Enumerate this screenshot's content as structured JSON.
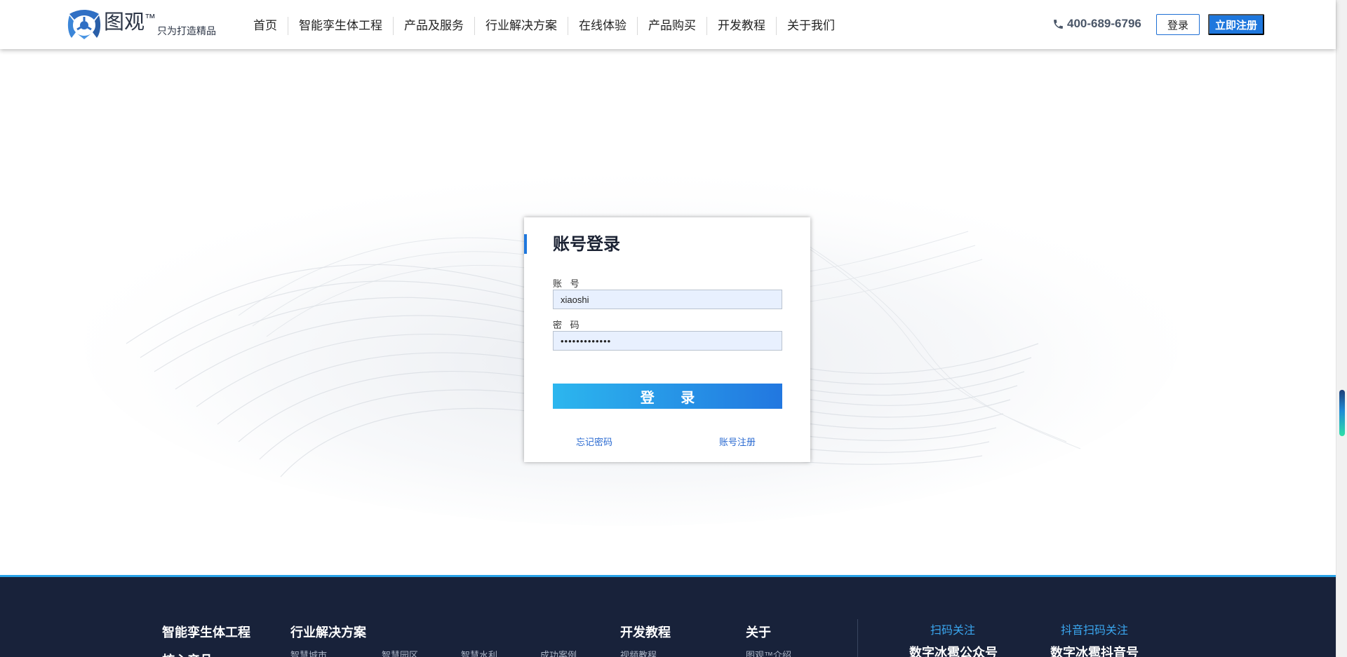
{
  "header": {
    "brand_name": "图观",
    "brand_tm": "™",
    "slogan": "只为打造精品",
    "nav": [
      "首页",
      "智能孪生体工程",
      "产品及服务",
      "行业解决方案",
      "在线体验",
      "产品购买",
      "开发教程",
      "关于我们"
    ],
    "phone": "400-689-6796",
    "login_label": "登录",
    "register_label": "立即注册"
  },
  "login": {
    "title": "账号登录",
    "account_label": "账 号",
    "account_value": "xiaoshi",
    "password_label": "密 码",
    "password_value": "•••••••••••••",
    "submit_label": "登 录",
    "forgot_label": "忘记密码",
    "register_label": "账号注册"
  },
  "footer": {
    "col1_title": "智能孪生体工程",
    "col1_sub": "核心产品",
    "col2_title": "行业解决方案",
    "col2_links": [
      "智慧城市",
      "智慧园区",
      "智慧水利",
      "成功案例"
    ],
    "col3_title": "开发教程",
    "col3_links": [
      "视频教程"
    ],
    "col4_title": "关于",
    "col4_links": [
      "图观™介绍"
    ],
    "follow_label": "扫码关注",
    "follow_name": "数字冰雹公众号",
    "douyin_label": "抖音扫码关注",
    "douyin_name": "数字冰雹抖音号"
  },
  "colors": {
    "brand_blue": "#1e77dd",
    "footer_bg": "#18223a",
    "footer_accent": "#29a3e8",
    "link_blue": "#2a6ad1"
  },
  "icons": [
    "logo-icon",
    "phone-icon"
  ]
}
